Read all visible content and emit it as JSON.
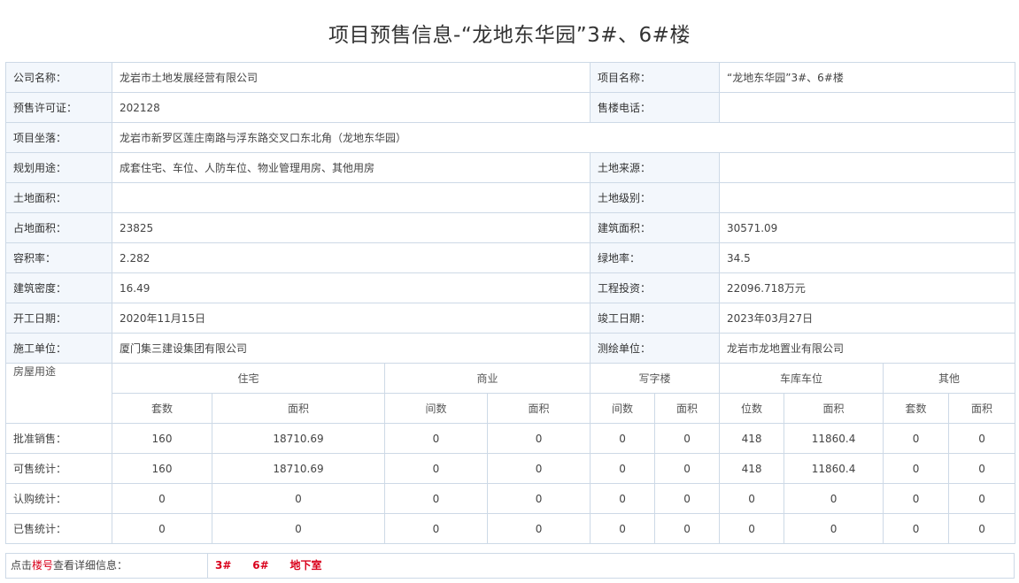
{
  "title": "项目预售信息-“龙地东华园”3#、6#楼",
  "info": {
    "company_label": "公司名称：",
    "company_value": "龙岩市土地发展经营有限公司",
    "project_label": "项目名称：",
    "project_value": "“龙地东华园”3#、6#楼",
    "permit_label": "预售许可证：",
    "permit_value": "202128",
    "phone_label": "售楼电话：",
    "phone_value": "",
    "location_label": "项目坐落：",
    "location_value": "龙岩市新罗区莲庄南路与浮东路交叉口东北角（龙地东华园）",
    "usage_label": "规划用途：",
    "usage_value": "成套住宅、车位、人防车位、物业管理用房、其他用房",
    "land_source_label": "土地来源：",
    "land_source_value": "",
    "land_area_label": "土地面积：",
    "land_area_value": "",
    "land_grade_label": "土地级别：",
    "land_grade_value": "",
    "site_area_label": "占地面积：",
    "site_area_value": "23825",
    "build_area_label": "建筑面积：",
    "build_area_value": "30571.09",
    "plot_ratio_label": "容积率：",
    "plot_ratio_value": "2.282",
    "green_ratio_label": "绿地率：",
    "green_ratio_value": "34.5",
    "density_label": "建筑密度：",
    "density_value": "16.49",
    "investment_label": "工程投资：",
    "investment_value": "22096.718万元",
    "start_label": "开工日期：",
    "start_value": "2020年11月15日",
    "finish_label": "竣工日期：",
    "finish_value": "2023年03月27日",
    "builder_label": "施工单位：",
    "builder_value": "厦门集三建设集团有限公司",
    "surveyor_label": "测绘单位：",
    "surveyor_value": "龙岩市龙地置业有限公司"
  },
  "stats": {
    "usage_header": "房屋用途",
    "groups": [
      "住宅",
      "商业",
      "写字楼",
      "车库车位",
      "其他"
    ],
    "subheaders": [
      "套数",
      "面积",
      "间数",
      "面积",
      "间数",
      "面积",
      "位数",
      "面积",
      "套数",
      "面积"
    ],
    "rows": [
      {
        "label": "批准销售：",
        "values": [
          "160",
          "18710.69",
          "0",
          "0",
          "0",
          "0",
          "418",
          "11860.4",
          "0",
          "0"
        ]
      },
      {
        "label": "可售统计：",
        "values": [
          "160",
          "18710.69",
          "0",
          "0",
          "0",
          "0",
          "418",
          "11860.4",
          "0",
          "0"
        ]
      },
      {
        "label": "认购统计：",
        "values": [
          "0",
          "0",
          "0",
          "0",
          "0",
          "0",
          "0",
          "0",
          "0",
          "0"
        ]
      },
      {
        "label": "已售统计：",
        "values": [
          "0",
          "0",
          "0",
          "0",
          "0",
          "0",
          "0",
          "0",
          "0",
          "0"
        ]
      }
    ]
  },
  "footer": {
    "prefix": "点击",
    "highlight": "楼号",
    "suffix": "查看详细信息：",
    "links": [
      "3#",
      "6#",
      "地下室"
    ]
  }
}
